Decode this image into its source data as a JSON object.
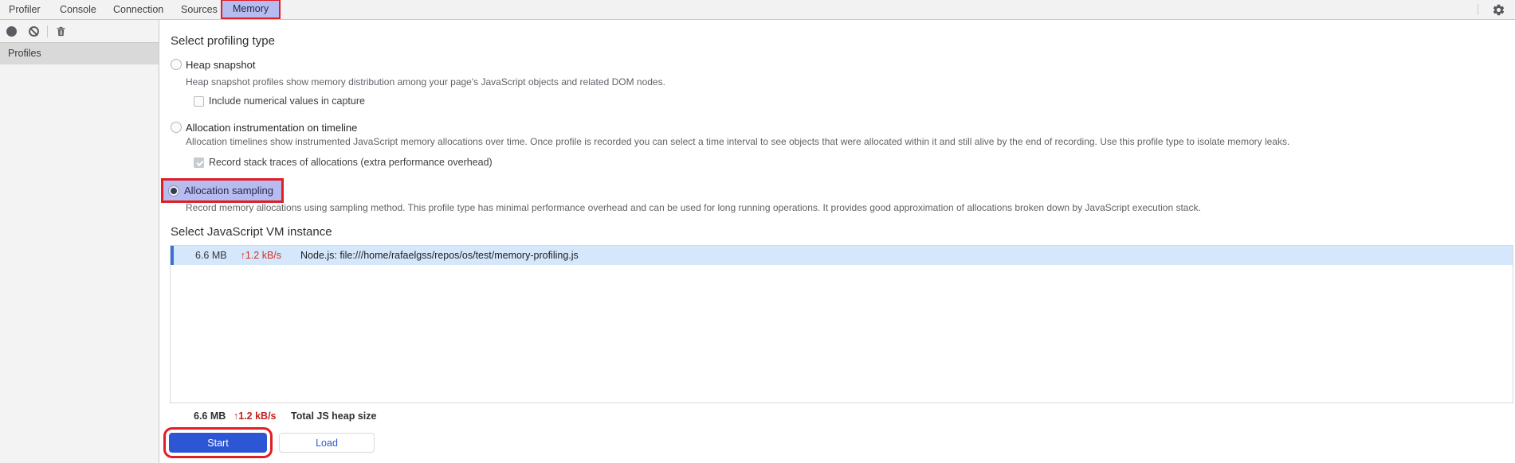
{
  "window": {
    "tabs": [
      {
        "label": "Profiler",
        "active": false
      },
      {
        "label": "Console",
        "active": false
      },
      {
        "label": "Connection",
        "active": false
      },
      {
        "label": "Sources",
        "active": false
      },
      {
        "label": "Memory",
        "active": true
      }
    ],
    "settings_icon": "gear-icon"
  },
  "toolbar": {
    "icons": [
      {
        "name": "record-icon"
      },
      {
        "name": "clear-icon"
      },
      {
        "name": "delete-icon"
      }
    ]
  },
  "sidebar": {
    "header": "Profiles"
  },
  "profiling": {
    "title": "Select profiling type",
    "options": [
      {
        "label": "Heap snapshot",
        "selected": false,
        "description": "Heap snapshot profiles show memory distribution among your page's JavaScript objects and related DOM nodes.",
        "checkbox": {
          "label": "Include numerical values in capture",
          "checked": false
        }
      },
      {
        "label": "Allocation instrumentation on timeline",
        "selected": false,
        "description": "Allocation timelines show instrumented JavaScript memory allocations over time. Once profile is recorded you can select a time interval to see objects that were allocated within it and still alive by the end of recording. Use this profile type to isolate memory leaks.",
        "checkbox": {
          "label": "Record stack traces of allocations (extra performance overhead)",
          "checked": true
        }
      },
      {
        "label": "Allocation sampling",
        "selected": true,
        "highlighted": true,
        "description": "Record memory allocations using sampling method. This profile type has minimal performance overhead and can be used for long running operations. It provides good approximation of allocations broken down by JavaScript execution stack."
      }
    ]
  },
  "vm": {
    "title": "Select JavaScript VM instance",
    "instances": [
      {
        "heap_size": "6.6 MB",
        "rate_arrow": "↑",
        "rate": "1.2 kB/s",
        "name": "Node.js: file:///home/rafaelgss/repos/os/test/memory-profiling.js",
        "selected": true
      }
    ],
    "totals": {
      "heap_size": "6.6 MB",
      "rate_arrow": "↑",
      "rate": "1.2 kB/s",
      "label": "Total JS heap size"
    }
  },
  "actions": {
    "start": "Start",
    "load": "Load"
  },
  "colors": {
    "accent_blue": "#2d56d5",
    "annotation_red": "#e01e25",
    "rate_red": "#d93025",
    "tab_highlight_lavender": "#b7bcf0",
    "selected_row_blue": "#d4e7fb",
    "selected_row_bar": "#3e70d6"
  }
}
